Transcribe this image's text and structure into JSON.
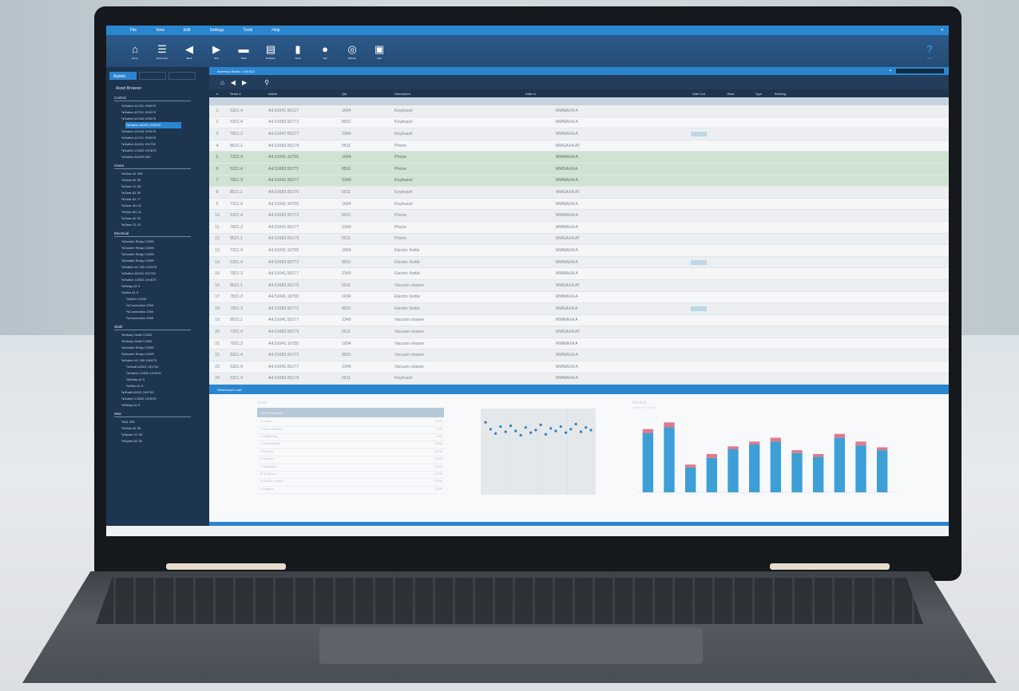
{
  "menu": [
    "File",
    "View",
    "Edit",
    "Settings",
    "Tools",
    "Help"
  ],
  "toolbar": [
    {
      "icon": "home-icon",
      "label": "Home"
    },
    {
      "icon": "document-icon",
      "label": "Document"
    },
    {
      "icon": "arrow-left-icon",
      "label": "Back"
    },
    {
      "icon": "arrow-right-icon",
      "label": "Next"
    },
    {
      "icon": "truck-icon",
      "label": "Track"
    },
    {
      "icon": "report-icon",
      "label": "Reflexes"
    },
    {
      "icon": "bar-chart-icon",
      "label": "Chart"
    },
    {
      "icon": "lightbulb-icon",
      "label": "Tips"
    },
    {
      "icon": "globe-icon",
      "label": "Planner"
    },
    {
      "icon": "person-icon",
      "label": "User"
    }
  ],
  "help_label": "Help",
  "sidebar": {
    "tabs": [
      "Assets",
      "",
      ""
    ],
    "title": "Asset Browser",
    "groups": [
      {
        "name": "Control",
        "items": [
          {
            "label": "Switch A1701 19V675",
            "lvl": 1
          },
          {
            "label": "Switch A7001 19V675",
            "lvl": 1
          },
          {
            "label": "Switch A1345 19V675",
            "lvl": 1
          },
          {
            "label": "Switch A4901 19V675",
            "lvl": 2,
            "sel": true
          },
          {
            "label": "Switch A2345 19V675",
            "lvl": 1
          },
          {
            "label": "Switch A1701 19V675",
            "lvl": 1
          },
          {
            "label": "Switch A1001 19V752",
            "lvl": 1
          },
          {
            "label": "Switch C2532 19V675",
            "lvl": 1
          },
          {
            "label": "Switch MJ299 400",
            "lvl": 1
          }
        ]
      },
      {
        "name": "Gears",
        "items": [
          {
            "label": "Gear A1 395",
            "lvl": 1
          },
          {
            "label": "Gear A2 35",
            "lvl": 1
          },
          {
            "label": "Gear C1 55",
            "lvl": 1
          },
          {
            "label": "Gear A2 35",
            "lvl": 1
          },
          {
            "label": "Gear A1 77",
            "lvl": 1
          },
          {
            "label": "Gear M1 31",
            "lvl": 1
          },
          {
            "label": "Gear M1 41",
            "lvl": 1
          },
          {
            "label": "Gear A2 25",
            "lvl": 1
          },
          {
            "label": "Gear C1 31",
            "lvl": 1
          }
        ]
      },
      {
        "name": "Electrical",
        "items": [
          {
            "label": "Double Relay C2399",
            "lvl": 1
          },
          {
            "label": "Double Relay C4399",
            "lvl": 1
          },
          {
            "label": "Double Relay C2399",
            "lvl": 1
          },
          {
            "label": "Double Relay C2399",
            "lvl": 1
          },
          {
            "label": "Switch A1 395 19V675",
            "lvl": 1
          },
          {
            "label": "Switch A2001 19V752",
            "lvl": 1
          },
          {
            "label": "Switch C2532 19V675",
            "lvl": 1
          },
          {
            "label": "Relay A1 5",
            "lvl": 1
          },
          {
            "label": "Wire A1 5",
            "lvl": 1
          },
          {
            "label": "Wire C2399",
            "lvl": 2
          },
          {
            "label": "Connection 2399",
            "lvl": 2
          },
          {
            "label": "Connection 2399",
            "lvl": 2
          },
          {
            "label": "Connection 2399",
            "lvl": 2
          }
        ]
      },
      {
        "name": "Shaft",
        "items": [
          {
            "label": "Heavy Shaft C2399",
            "lvl": 1
          },
          {
            "label": "Heavy Shaft C2399",
            "lvl": 1
          },
          {
            "label": "Double Relay C2399",
            "lvl": 1
          },
          {
            "label": "Double Relay C2399",
            "lvl": 1
          },
          {
            "label": "Switch A1 395 19V675",
            "lvl": 1
          },
          {
            "label": "Shaft A2001 19V752",
            "lvl": 2
          },
          {
            "label": "Switch C2532 19V675",
            "lvl": 2
          },
          {
            "label": "Relay A1 5",
            "lvl": 2
          },
          {
            "label": "Wire A1 5",
            "lvl": 2
          },
          {
            "label": "Shaft A1001 19V752",
            "lvl": 1
          },
          {
            "label": "Switch C2532 19V675",
            "lvl": 1
          },
          {
            "label": "Relay A1 5",
            "lvl": 1
          }
        ]
      },
      {
        "name": "Misc",
        "items": [
          {
            "label": "A1 395",
            "lvl": 1
          },
          {
            "label": "Gear A2 35",
            "lvl": 1
          },
          {
            "label": "Spare C1 55",
            "lvl": 1
          },
          {
            "label": "Spare A2 35",
            "lvl": 1
          }
        ]
      }
    ]
  },
  "tab_title": "Inventory Sheet > 119.912",
  "columns": [
    "#",
    "Serial #",
    "Article",
    "Qty",
    "Description",
    "Date In",
    "Date Out",
    "Rack",
    "Type",
    "Building"
  ],
  "rows": [
    {
      "n": "1",
      "serial": "5321.4",
      "article": "A4.51041.55127",
      "qty": "1694",
      "desc": "Keyboard",
      "date_in": "",
      "site": "MMMAXA A",
      "date_out": "",
      "rack": "",
      "type": "",
      "style": "alt"
    },
    {
      "n": "2",
      "serial": "5321.4",
      "article": "A4.51683.55772",
      "qty": "8501",
      "desc": "Keyboard",
      "date_in": "",
      "site": "MMMAXA A",
      "date_out": "",
      "rack": "",
      "type": "",
      "style": ""
    },
    {
      "n": "3",
      "serial": "7821.3",
      "article": "A4.51047.55177",
      "qty": "2349",
      "desc": "Keyboard",
      "date_in": "",
      "site": "MMMAXA A",
      "date_out": "",
      "rack": "",
      "type": "",
      "style": "alt",
      "hl": true
    },
    {
      "n": "4",
      "serial": "8521.1",
      "article": "A4.51683.55179",
      "qty": "5511",
      "desc": "Phone",
      "date_in": "",
      "site": "MMGAXA AT",
      "date_out": "",
      "rack": "",
      "type": "",
      "style": ""
    },
    {
      "n": "5",
      "serial": "7321.4",
      "article": "A4.51041.16755",
      "qty": "1694",
      "desc": "Phone",
      "date_in": "",
      "site": "MMMAXA A",
      "date_out": "",
      "rack": "",
      "type": "",
      "style": "green"
    },
    {
      "n": "6",
      "serial": "5321.4",
      "article": "A4.51683.55772",
      "qty": "8501",
      "desc": "Phone",
      "date_in": "",
      "site": "MMGAXA A",
      "date_out": "",
      "rack": "",
      "type": "",
      "style": "green"
    },
    {
      "n": "7",
      "serial": "7821.3",
      "article": "A4.51041.55177",
      "qty": "2349",
      "desc": "Keyboard",
      "date_in": "",
      "site": "MMMAXA A",
      "date_out": "",
      "rack": "",
      "type": "",
      "style": "green"
    },
    {
      "n": "8",
      "serial": "8521.1",
      "article": "A4.51683.55179",
      "qty": "5511",
      "desc": "Keyboard",
      "date_in": "",
      "site": "MMGAXA AT",
      "date_out": "",
      "rack": "",
      "type": "",
      "style": "alt"
    },
    {
      "n": "9",
      "serial": "7321.4",
      "article": "A4.51041.16755",
      "qty": "1694",
      "desc": "Keyboard",
      "date_in": "",
      "site": "MMMAXA A",
      "date_out": "",
      "rack": "",
      "type": "",
      "style": ""
    },
    {
      "n": "10",
      "serial": "5321.4",
      "article": "A4.51683.55772",
      "qty": "8501",
      "desc": "Phone",
      "date_in": "",
      "site": "MMMAXA A",
      "date_out": "",
      "rack": "",
      "type": "",
      "style": "alt"
    },
    {
      "n": "11",
      "serial": "7821.3",
      "article": "A4.51041.55177",
      "qty": "2349",
      "desc": "Phone",
      "date_in": "",
      "site": "MMMAXA A",
      "date_out": "",
      "rack": "",
      "type": "",
      "style": ""
    },
    {
      "n": "12",
      "serial": "8521.1",
      "article": "A4.51683.55179",
      "qty": "5511",
      "desc": "Phone",
      "date_in": "",
      "site": "MMGAXA AT",
      "date_out": "",
      "rack": "",
      "type": "",
      "style": "alt"
    },
    {
      "n": "13",
      "serial": "7321.4",
      "article": "A4.51041.16755",
      "qty": "1694",
      "desc": "Electric Kettle",
      "date_in": "",
      "site": "MMMAXA A",
      "date_out": "",
      "rack": "",
      "type": "",
      "style": ""
    },
    {
      "n": "14",
      "serial": "5321.4",
      "article": "A4.51683.55772",
      "qty": "8501",
      "desc": "Electric Kettle",
      "date_in": "",
      "site": "MMMAXA A",
      "date_out": "",
      "rack": "",
      "type": "",
      "style": "alt",
      "hl": true
    },
    {
      "n": "15",
      "serial": "7821.3",
      "article": "A4.51041.55177",
      "qty": "2349",
      "desc": "Electric Kettle",
      "date_in": "",
      "site": "MMMAXA A",
      "date_out": "",
      "rack": "",
      "type": "",
      "style": ""
    },
    {
      "n": "16",
      "serial": "8521.1",
      "article": "A4.51683.55179",
      "qty": "5511",
      "desc": "Vacuum cleaner",
      "date_in": "",
      "site": "MMGAXA AT",
      "date_out": "",
      "rack": "",
      "type": "",
      "style": "alt"
    },
    {
      "n": "17",
      "serial": "7821.3",
      "article": "A4.51041.16755",
      "qty": "1694",
      "desc": "Electric Kettle",
      "date_in": "",
      "site": "MMMAXA A",
      "date_out": "",
      "rack": "",
      "type": "",
      "style": ""
    },
    {
      "n": "18",
      "serial": "7821.3",
      "article": "A4.51683.55772",
      "qty": "8501",
      "desc": "Electric Kettle",
      "date_in": "",
      "site": "MMGAXA A",
      "date_out": "",
      "rack": "",
      "type": "",
      "style": "alt",
      "hl": true
    },
    {
      "n": "19",
      "serial": "8521.1",
      "article": "A4.51041.55177",
      "qty": "2349",
      "desc": "Vacuum cleaner",
      "date_in": "",
      "site": "MMMAXA A",
      "date_out": "",
      "rack": "",
      "type": "",
      "style": ""
    },
    {
      "n": "20",
      "serial": "7321.4",
      "article": "A4.51683.55179",
      "qty": "5511",
      "desc": "Vacuum cleaner",
      "date_in": "",
      "site": "MMGAXA AT",
      "date_out": "",
      "rack": "",
      "type": "",
      "style": "alt"
    },
    {
      "n": "21",
      "serial": "7821.3",
      "article": "A4.51041.16755",
      "qty": "1694",
      "desc": "Vacuum cleaner",
      "date_in": "",
      "site": "MMMAXA A",
      "date_out": "",
      "rack": "",
      "type": "",
      "style": ""
    },
    {
      "n": "22",
      "serial": "8321.4",
      "article": "A4.51683.55772",
      "qty": "8501",
      "desc": "Vacuum cleaner",
      "date_in": "",
      "site": "MMMAXA A",
      "date_out": "",
      "rack": "",
      "type": "",
      "style": "alt"
    },
    {
      "n": "23",
      "serial": "5321.4",
      "article": "A4.51041.55177",
      "qty": "2349",
      "desc": "Vacuum cleaner",
      "date_in": "",
      "site": "MMMAXA A",
      "date_out": "",
      "rack": "",
      "type": "",
      "style": ""
    },
    {
      "n": "24",
      "serial": "5321.4",
      "article": "A4.51683.55179",
      "qty": "5511",
      "desc": "Keyboard",
      "date_in": "",
      "site": "MMMAXA A",
      "date_out": "",
      "rack": "",
      "type": "",
      "style": "alt"
    }
  ],
  "panel_title": "Warehouse Load",
  "list_panel": {
    "header": "Stock",
    "selected": "Top Performers",
    "rows": [
      {
        "label": "1 Lorem",
        "value": "8.1%"
      },
      {
        "label": "2 Dolor sit amet",
        "value": "7.6%"
      },
      {
        "label": "3 Adipiscing",
        "value": "7.3%"
      },
      {
        "label": "4 Consectetur",
        "value": "6.8%"
      },
      {
        "label": "5 Elit sed",
        "value": "6.6%"
      },
      {
        "label": "6 Tempor",
        "value": "6.5%"
      },
      {
        "label": "7 Incididunt",
        "value": "6.1%"
      },
      {
        "label": "8 Ut labore",
        "value": "5.9%"
      },
      {
        "label": "9 Dolore magna",
        "value": "5.8%"
      },
      {
        "label": "10 Aliqua",
        "value": "5.6%"
      }
    ]
  },
  "bar_panel": {
    "title": "Monthly",
    "subtitle": "Intake & Outflow"
  },
  "chart_data": [
    {
      "type": "scatter",
      "series": [
        {
          "values": [
            84,
            76,
            71,
            79,
            73,
            80,
            74,
            69,
            78,
            72,
            75,
            81,
            70,
            77,
            74,
            79,
            72,
            76,
            82,
            73,
            78,
            75
          ]
        }
      ],
      "ylim": [
        0,
        100
      ]
    },
    {
      "type": "bar",
      "categories": [
        "",
        "",
        "",
        "",
        "",
        "",
        "",
        "",
        "",
        "",
        "",
        ""
      ],
      "series": [
        {
          "values": [
            62,
            68,
            26,
            36,
            45,
            50,
            53,
            41,
            37,
            57,
            49,
            44
          ]
        },
        {
          "values": [
            4,
            5,
            3,
            4,
            3,
            3,
            4,
            3,
            3,
            4,
            4,
            3
          ]
        }
      ],
      "colors": [
        "#3d9fd6",
        "#e0798a"
      ],
      "ylim": [
        0,
        80
      ]
    }
  ]
}
